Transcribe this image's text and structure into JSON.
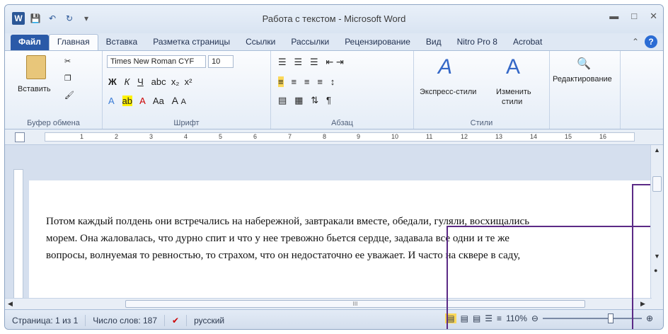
{
  "window": {
    "title": "Работа с текстом - Microsoft Word"
  },
  "qat": {
    "logo": "W",
    "save_icon": "save-icon",
    "undo_icon": "undo-icon",
    "redo_icon": "redo-icon"
  },
  "tabs": [
    {
      "label": "Файл"
    },
    {
      "label": "Главная"
    },
    {
      "label": "Вставка"
    },
    {
      "label": "Разметка страницы"
    },
    {
      "label": "Ссылки"
    },
    {
      "label": "Рассылки"
    },
    {
      "label": "Рецензирование"
    },
    {
      "label": "Вид"
    },
    {
      "label": "Nitro Pro 8"
    },
    {
      "label": "Acrobat"
    }
  ],
  "ribbon": {
    "clipboard": {
      "paste": "Вставить",
      "label": "Буфер обмена"
    },
    "font": {
      "name": "Times New Roman CYF",
      "size": "10",
      "label": "Шрифт",
      "bold": "Ж",
      "italic": "К",
      "underline": "Ч",
      "aa": "Aa",
      "grow": "A",
      "shrink": "A"
    },
    "paragraph": {
      "label": "Абзац",
      "pilcrow": "¶"
    },
    "styles": {
      "express": "Экспресс-стили",
      "change1": "Изменить",
      "change2": "стили",
      "label": "Стили"
    },
    "editing": {
      "label": "Редактирование"
    }
  },
  "ruler": {
    "numbers": [
      "1",
      "2",
      "3",
      "4",
      "5",
      "6",
      "7",
      "8",
      "9",
      "10",
      "11",
      "12",
      "13",
      "14",
      "15",
      "16"
    ]
  },
  "document": {
    "lines": [
      "Потом каждый полдень они встречались на набережной, завтракали вместе, обедали, гуляли, восхищались",
      "морем. Она жаловалась, что дурно спит и что у нее тревожно бьется сердце, задавала все одни и те же",
      "вопросы, волнуемая то ревностью, то страхом, что он недостаточно ее уважает. И часто на сквере в саду,"
    ]
  },
  "status": {
    "page": "Страница: 1 из 1",
    "words": "Число слов: 187",
    "lang": "русский",
    "zoom": "110%",
    "zoom_level": 0.7
  },
  "hscroll_mark": "III"
}
